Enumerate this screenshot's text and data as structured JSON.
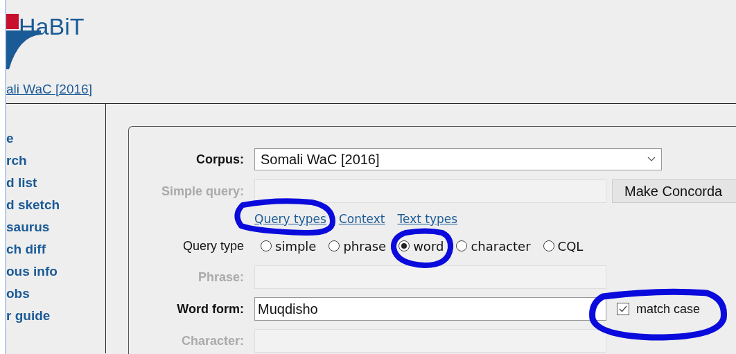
{
  "logo": {
    "text": "HaBiT"
  },
  "corpus_link": "ali WaC [2016]",
  "sidebar": {
    "items": [
      {
        "label": "e"
      },
      {
        "label": "rch"
      },
      {
        "label": "d list"
      },
      {
        "label": "d sketch"
      },
      {
        "label": "saurus"
      },
      {
        "label": "ch diff"
      },
      {
        "label": "ous info"
      },
      {
        "label": "obs"
      },
      {
        "label": "r guide"
      }
    ]
  },
  "form": {
    "rows": [
      {
        "kind": "select",
        "label": "Corpus:",
        "value": "Somali WaC [2016]",
        "disabled": false
      },
      {
        "kind": "field",
        "label": "Simple query:",
        "disabled": true,
        "button": "Make Concorda"
      },
      {
        "kind": "links",
        "links": [
          "Query types",
          "Context",
          "Text types"
        ]
      },
      {
        "kind": "radios",
        "label": "Query type",
        "options": [
          {
            "label": "simple",
            "selected": false
          },
          {
            "label": "phrase",
            "selected": false
          },
          {
            "label": "word",
            "selected": true
          },
          {
            "label": "character",
            "selected": false
          },
          {
            "label": "CQL",
            "selected": false
          }
        ]
      },
      {
        "kind": "field",
        "label": "Phrase:",
        "disabled": true
      },
      {
        "kind": "field",
        "label": "Word form:",
        "disabled": false,
        "value": "Muqdisho",
        "checkbox": {
          "label": "match case",
          "checked": true
        }
      },
      {
        "kind": "field",
        "label": "Character:",
        "disabled": true
      }
    ]
  }
}
